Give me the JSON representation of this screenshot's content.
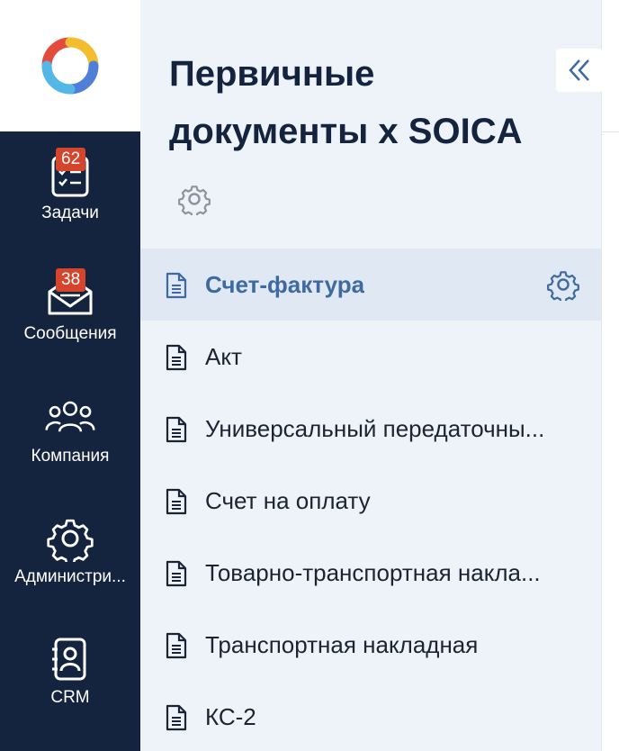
{
  "rail": {
    "items": [
      {
        "label": "Задачи",
        "badge": "62",
        "icon": "tasks-icon"
      },
      {
        "label": "Сообщения",
        "badge": "38",
        "icon": "mail-icon"
      },
      {
        "label": "Компания",
        "badge": null,
        "icon": "people-icon"
      },
      {
        "label": "Администри...",
        "badge": null,
        "icon": "gear-icon"
      },
      {
        "label": "CRM",
        "badge": null,
        "icon": "contact-book-icon"
      }
    ]
  },
  "section": {
    "title": "Первичные документы х SOICA",
    "collapse_icon": "double-chevron-left-icon"
  },
  "documents": [
    {
      "label": "Счет-фактура",
      "active": true
    },
    {
      "label": "Акт",
      "active": false
    },
    {
      "label": "Универсальный передаточны...",
      "active": false
    },
    {
      "label": "Счет на оплату",
      "active": false
    },
    {
      "label": "Товарно-транспортная накла...",
      "active": false
    },
    {
      "label": "Транспортная накладная",
      "active": false
    },
    {
      "label": "КС-2",
      "active": false
    }
  ],
  "colors": {
    "rail_bg": "#14243f",
    "badge": "#d4452b",
    "panel_bg": "#eef3f9",
    "active_row": "#dfe8f3",
    "accent": "#3e6a9f"
  }
}
